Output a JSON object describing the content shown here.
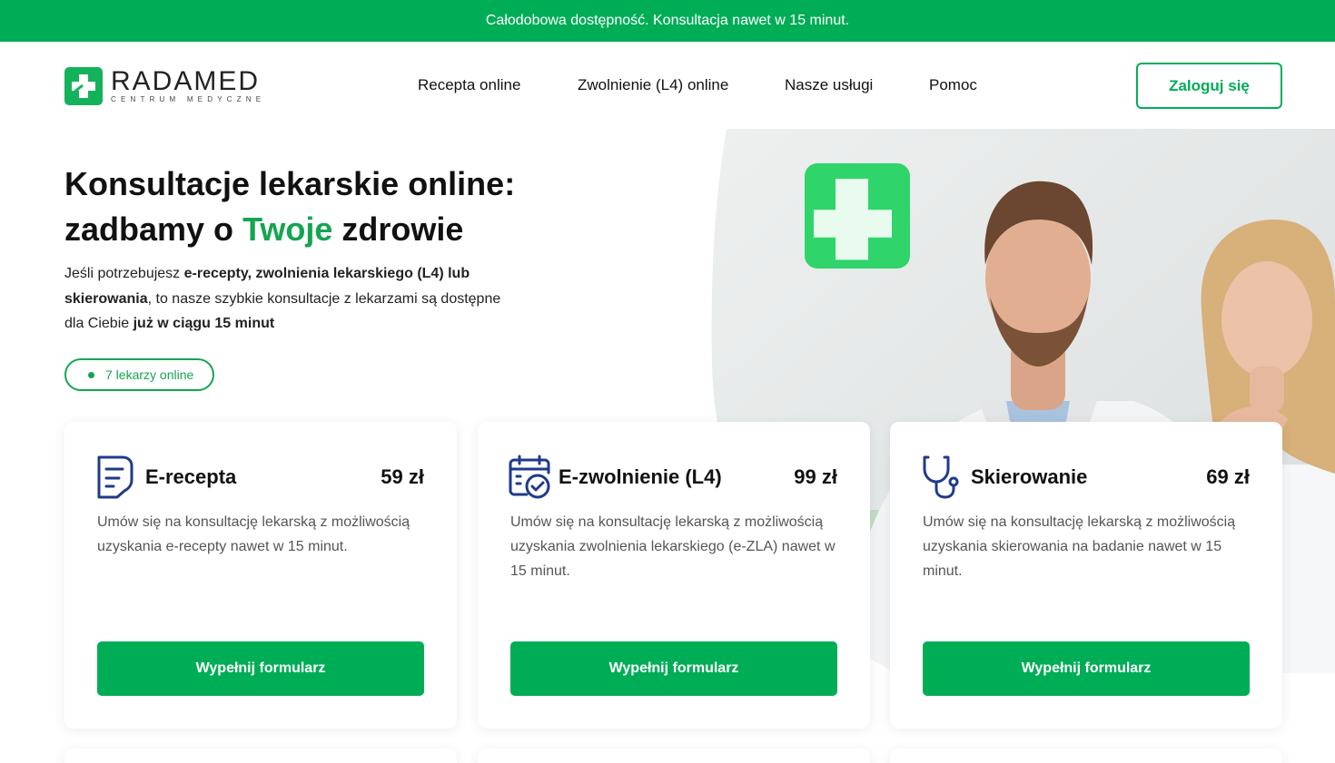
{
  "announcement": "Całodobowa dostępność. Konsultacja nawet w 15 minut.",
  "logo": {
    "name": "RADAMED",
    "subtitle": "CENTRUM MEDYCZNE"
  },
  "nav": {
    "items": [
      {
        "label": "Recepta online"
      },
      {
        "label": "Zwolnienie (L4) online"
      },
      {
        "label": "Nasze usługi"
      },
      {
        "label": "Pomoc"
      }
    ],
    "login_label": "Zaloguj się"
  },
  "hero": {
    "title_line1": "Konsultacje lekarskie online:",
    "title_line2_pre": "zadbamy o ",
    "title_line2_accent": "Twoje",
    "title_line2_post": " zdrowie",
    "desc_parts": [
      "Jeśli potrzebujesz ",
      "e-recepty, zwolnienia lekarskiego (L4) lub skierowania",
      ", to nasze szybkie konsultacje z lekarzami są dostępne dla Ciebie ",
      "już w ciągu 15 minut"
    ],
    "online_badge": "7 lekarzy online"
  },
  "cards": [
    {
      "icon": "prescription-icon",
      "title": "E-recepta",
      "price": "59 zł",
      "description": "Umów się na konsultację lekarską z możliwością uzyskania e-recepty nawet w 15 minut.",
      "button": "Wypełnij formularz"
    },
    {
      "icon": "calendar-check-icon",
      "title": "E-zwolnienie (L4)",
      "price": "99 zł",
      "description": "Umów się na konsultację lekarską z możliwością uzyskania zwolnienia lekarskiego (e-ZLA) nawet w 15 minut.",
      "button": "Wypełnij formularz"
    },
    {
      "icon": "stethoscope-icon",
      "title": "Skierowanie",
      "price": "69 zł",
      "description": "Umów się na konsultację lekarską z możliwością uzyskania skierowania na badanie nawet w 15 minut.",
      "button": "Wypełnij formularz"
    }
  ],
  "colors": {
    "brand_green": "#00ad57",
    "accent_green": "#14a550",
    "icon_blue": "#1f3a8a"
  }
}
